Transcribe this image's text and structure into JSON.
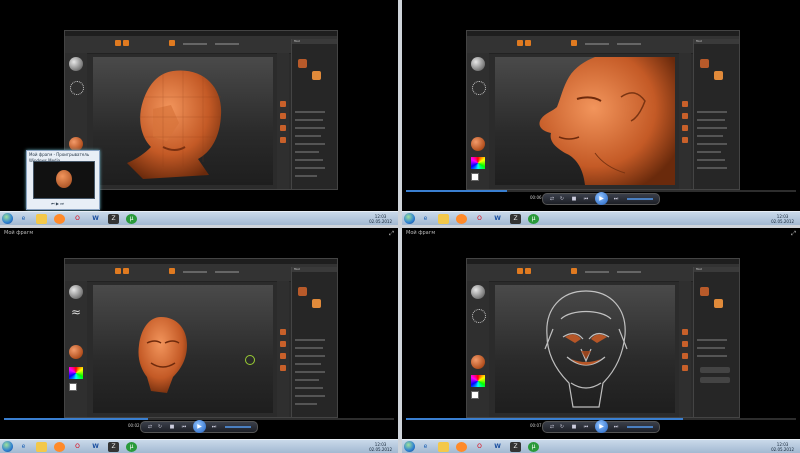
{
  "window_title": "Мой фрагм",
  "quadrants": [
    {
      "id": "q1",
      "time": "",
      "seek_progress": 0.0,
      "has_title": false,
      "mini_preview": {
        "title": "Мой фрагм - Проигрыватель Windows Media"
      }
    },
    {
      "id": "q2",
      "time": "00:06",
      "seek_progress": 0.26,
      "has_title": false
    },
    {
      "id": "q3",
      "time": "00:02",
      "seek_progress": 0.37,
      "has_title": true
    },
    {
      "id": "q4",
      "time": "00:07",
      "seek_progress": 0.71,
      "has_title": true
    }
  ],
  "zbrush": {
    "tray_header": "Tool"
  },
  "taskbar": {
    "apps": [
      "ie-icon",
      "explorer-icon",
      "media-player-icon",
      "opera-icon",
      "word-icon",
      "zbrush-icon",
      "utorrent-icon"
    ],
    "clock_time": "12:03",
    "clock_date": "02.05.2012"
  },
  "colors": {
    "accent_orange": "#e07a20",
    "seek_blue": "#3a7fd0",
    "taskbar": "#b5c8dd",
    "clay": "#c8602a"
  }
}
